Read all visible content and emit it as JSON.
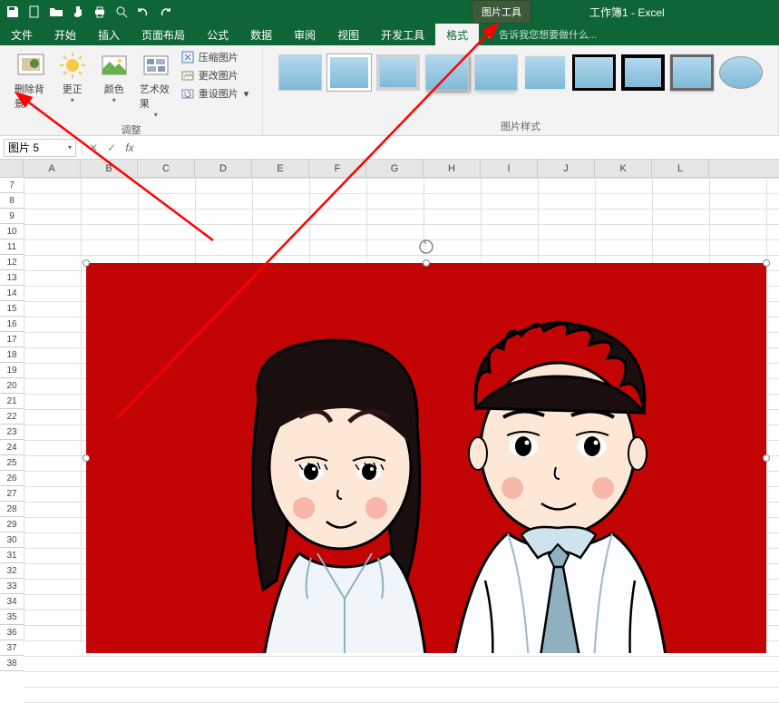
{
  "app": {
    "title": "工作簿1 - Excel",
    "contextual_tab": "图片工具"
  },
  "menu": {
    "file": "文件",
    "home": "开始",
    "insert": "插入",
    "layout": "页面布局",
    "formulas": "公式",
    "data": "数据",
    "review": "审阅",
    "view": "视图",
    "developer": "开发工具",
    "format": "格式",
    "tell_me": "告诉我您想要做什么..."
  },
  "ribbon": {
    "remove_bg": "删除背景",
    "corrections": "更正",
    "color": "颜色",
    "artistic": "艺术效果",
    "compress": "压缩图片",
    "change": "更改图片",
    "reset": "重设图片",
    "group_adjust": "调整",
    "group_styles": "图片样式"
  },
  "namebox": {
    "value": "图片 5"
  },
  "columns": [
    "A",
    "B",
    "C",
    "D",
    "E",
    "F",
    "G",
    "H",
    "I",
    "J",
    "K",
    "L"
  ],
  "rows": [
    "7",
    "8",
    "9",
    "10",
    "11",
    "12",
    "13",
    "14",
    "15",
    "16",
    "17",
    "18",
    "19",
    "20",
    "21",
    "22",
    "23",
    "24",
    "25",
    "26",
    "27",
    "28",
    "29",
    "30",
    "31",
    "32",
    "33",
    "34",
    "35",
    "36",
    "37",
    "38"
  ]
}
